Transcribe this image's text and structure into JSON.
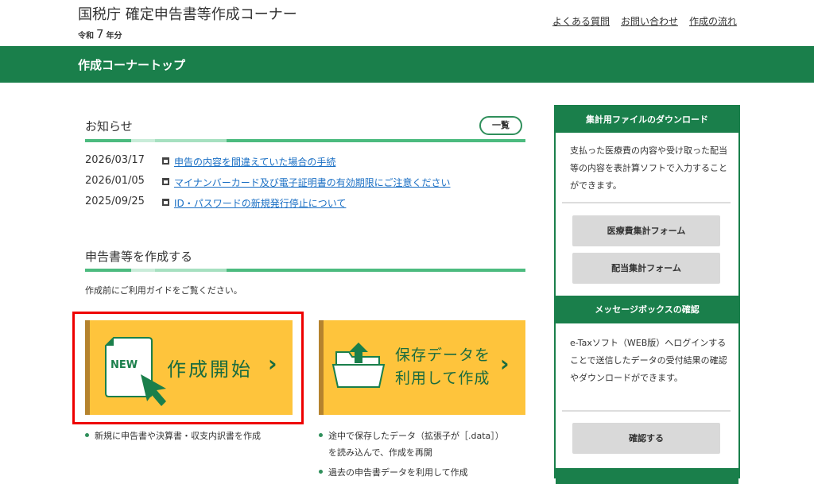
{
  "header": {
    "title": "国税庁 確定申告書等作成コーナー",
    "era_prefix": "令和",
    "era_year": "7",
    "era_suffix": "年分",
    "links": [
      "よくある質問",
      "お問い合わせ",
      "作成の流れ"
    ]
  },
  "page_bar": "作成コーナートップ",
  "notices": {
    "heading": "お知らせ",
    "more": "一覧",
    "items": [
      {
        "date": "2026/03/17",
        "title": "申告の内容を間違えていた場合の手続"
      },
      {
        "date": "2026/01/05",
        "title": "マイナンバーカード及び電子証明書の有効期限にご注意ください"
      },
      {
        "date": "2025/09/25",
        "title": "ID・パスワードの新規発行停止について"
      }
    ]
  },
  "create": {
    "heading": "申告書等を作成する",
    "guide": "作成前にご利用ガイドをご覧ください。",
    "new_card": {
      "badge": "NEW",
      "label": "作成開始",
      "bullets": [
        "新規に申告書や決算書・収支内訳書を作成"
      ]
    },
    "saved_card": {
      "label_line1": "保存データを",
      "label_line2": "利用して作成",
      "bullets": [
        "途中で保存したデータ（拡張子が［.data］）",
        "を読み込んで、作成を再開",
        "過去の申告書データを利用して作成"
      ]
    }
  },
  "sidebar": {
    "download": {
      "heading": "集計用ファイルのダウンロード",
      "text": "支払った医療費の内容や受け取った配当等の内容を表計算ソフトで入力することができます。",
      "buttons": [
        "医療費集計フォーム",
        "配当集計フォーム"
      ]
    },
    "messagebox": {
      "heading": "メッセージボックスの確認",
      "text": "e-Taxソフト（WEB版）へログインすることで送信したデータの受付結果の確認やダウンロードができます。",
      "button": "確認する"
    }
  },
  "colors": {
    "brand_green": "#1a7f4b",
    "card_yellow": "#fec43c",
    "link_blue": "#1a6fc4",
    "highlight_red": "#e00000"
  }
}
